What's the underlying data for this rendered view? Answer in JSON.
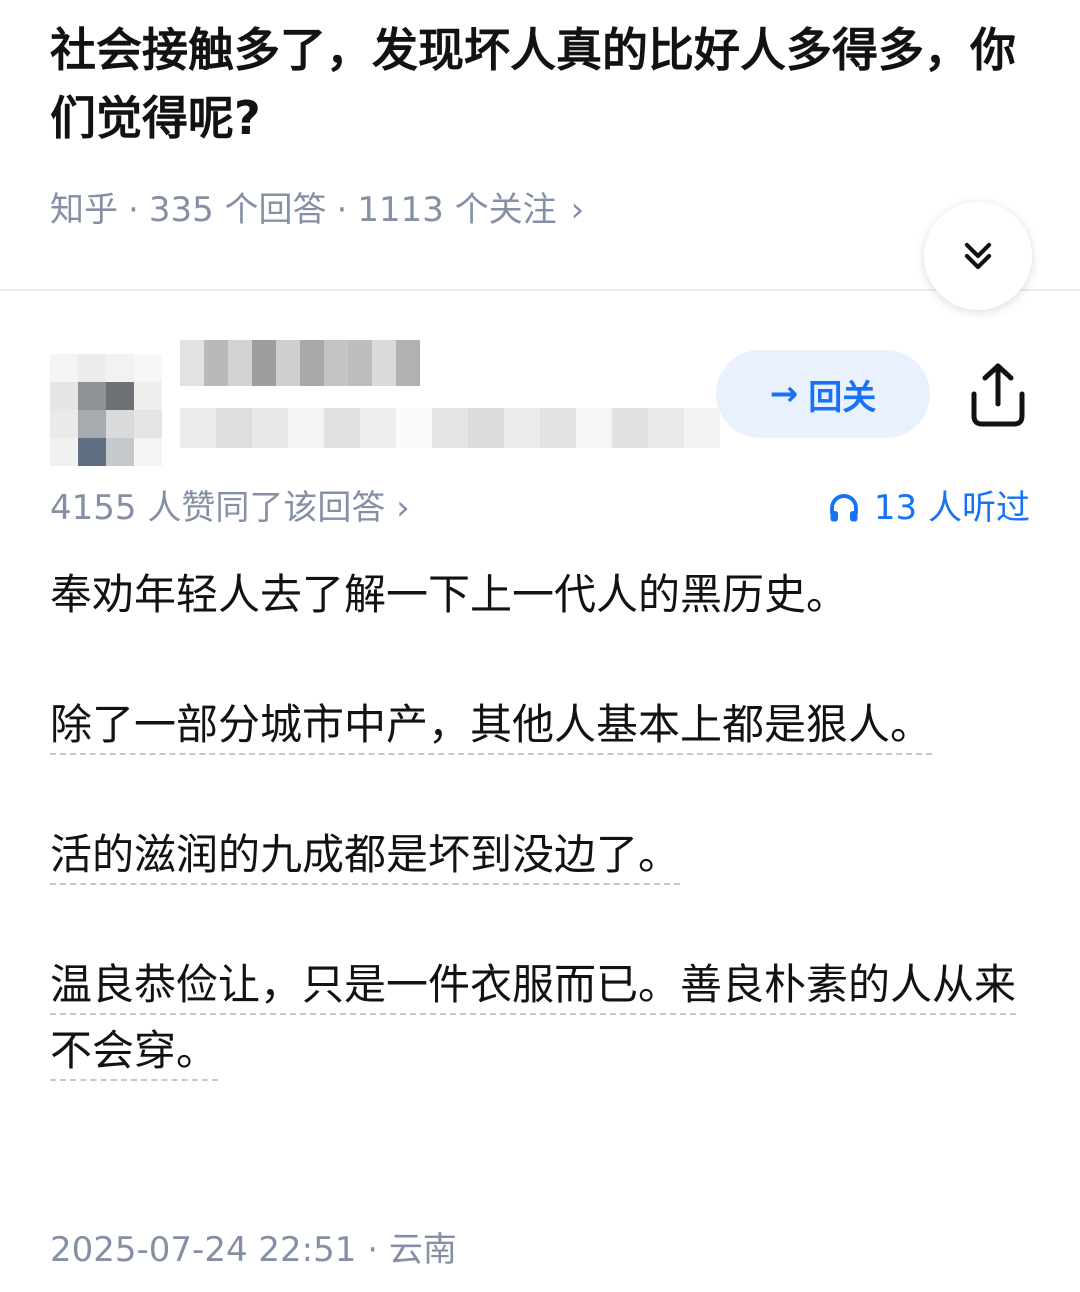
{
  "question": {
    "title": "社会接触多了，发现坏人真的比好人多得多，你们觉得呢?",
    "meta": {
      "source": "知乎",
      "separator": "·",
      "answers": "335 个回答",
      "followers": "1113 个关注",
      "chevron": "›"
    }
  },
  "author": {
    "follow_arrow": "→",
    "follow_label": "回关"
  },
  "stats": {
    "votes": "4155 人赞同了该回答",
    "votes_chevron": "›",
    "listens": "13 人听过"
  },
  "answer": {
    "p1": "奉劝年轻人去了解一下上一代人的黑历史。",
    "p2": "除了一部分城市中产，其他人基本上都是狠人。",
    "p3": "活的滋润的九成都是坏到没边了。",
    "p4": "温良恭俭让，只是一件衣服而已。善良朴素的人从来不会穿。"
  },
  "footer": {
    "datetime": "2025-07-24 22:51",
    "separator": "·",
    "location": "云南"
  },
  "colors": {
    "accent": "#1772f6",
    "muted": "#8590a6",
    "text": "#121212",
    "follow_bg": "#e9f1fd"
  },
  "icons": {
    "expand": "double-chevron-down-icon",
    "share": "share-icon",
    "listen": "headphones-icon"
  }
}
